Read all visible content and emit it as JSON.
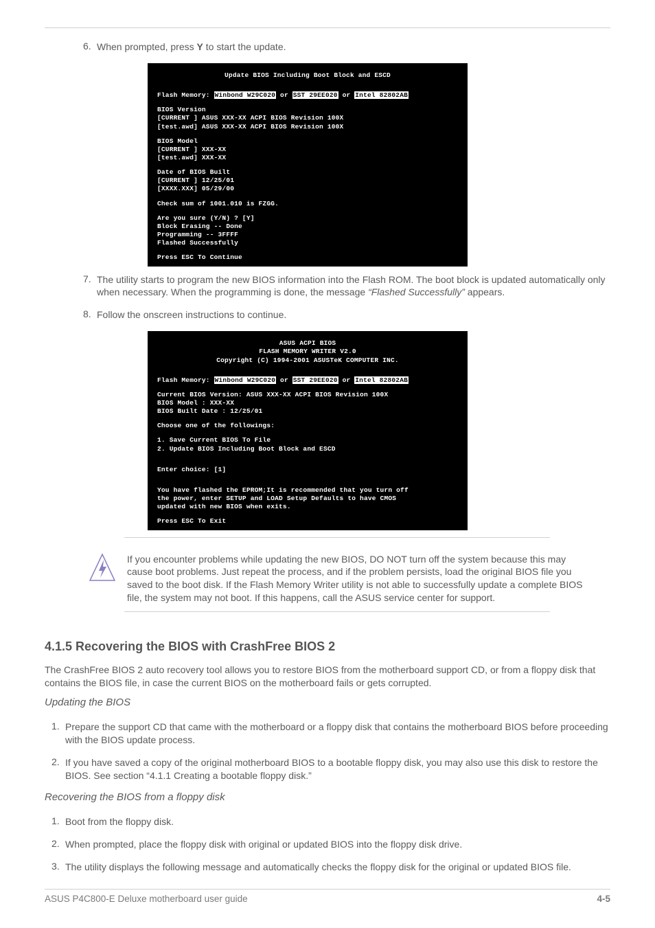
{
  "step6": {
    "num": "6.",
    "text_before": "When prompted, press ",
    "key": "Y",
    "text_after": " to start the update."
  },
  "bios1": {
    "title": "Update BIOS Including Boot Block and ESCD",
    "flash_label": "Flash Memory: ",
    "flash1": "Winbond W29C020",
    "or": " or ",
    "flash2": "SST 29EE020",
    "flash3": "Intel 82802AB",
    "bv_header": "BIOS Version",
    "bv_current": "[CURRENT ] ASUS XXX-XX ACPI BIOS Revision 100X",
    "bv_test": "[test.awd] ASUS XXX-XX ACPI BIOS Revision 100X",
    "bm_header": "BIOS Model",
    "bm_current": "[CURRENT ] XXX-XX",
    "bm_test": "[test.awd] XXX-XX",
    "date_header": "Date of BIOS Built",
    "date_current": "[CURRENT ] 12/25/01",
    "date_test": "[XXXX.XXX] 05/29/00",
    "checksum": "Check sum of 1001.010 is FZGG.",
    "confirm_q": "Are you sure (Y/N) ? ",
    "confirm_a": "[Y]",
    "erase_l": "Block Erasing  -- ",
    "erase_r": "Done",
    "prog_l": "Programming    -- ",
    "prog_r": "3FFFF",
    "flashed": "Flashed Successfully",
    "press": "Press ",
    "esc": "ESC",
    "press2": " To Continue"
  },
  "step7": {
    "num": "7.",
    "text": "The utility starts to program the new BIOS information into the Flash ROM. The boot block is updated automatically only when necessary. When the programming is done, the message ",
    "italic": "“Flashed Successfully”",
    "text2": " appears."
  },
  "step8": {
    "num": "8.",
    "text": "Follow the onscreen instructions to continue."
  },
  "bios2": {
    "t1": "ASUS ACPI BIOS",
    "t2": "FLASH MEMORY WRITER V2.0",
    "t3": "Copyright (C) 1994-2001 ASUSTeK COMPUTER INC.",
    "cur_bios": "Current BIOS Version: ",
    "cur_bios_v": "ASUS XXX-XX ACPI BIOS Revision 100X",
    "model_l": "BIOS Model          : ",
    "model_v": "XXX-XX",
    "built_l": "BIOS Built Date     : ",
    "built_v": "12/25/01",
    "choose": "Choose one of the followings:",
    "opt1": "1. Save Current BIOS To File",
    "opt2": "2. Update BIOS Including Boot Block and ESCD",
    "enter_l": "Enter choice: ",
    "enter_v": "[1]",
    "msg1": "You have flashed the EPROM;It is recommended that you turn off",
    "msg2": "the power, enter SETUP and LOAD Setup Defaults to have CMOS",
    "msg3": "updated with new BIOS when exits.",
    "press": "Press ",
    "esc": "ESC",
    "press2": " To Exit"
  },
  "note": "If you encounter problems while updating the new BIOS, DO NOT turn off the system because this may cause boot problems. Just repeat the process, and if the problem persists, load the original BIOS file you saved to the boot disk. If the Flash Memory Writer utility is not able to successfully update a complete BIOS file, the system may not boot. If this happens, call the ASUS service center for support.",
  "crashfree": {
    "title": "4.1.5 Recovering the BIOS with CrashFree BIOS 2",
    "sub1": "Updating the BIOS",
    "sub2": "Recovering the BIOS from a floppy disk",
    "intro": "The CrashFree BIOS 2 auto recovery tool allows you to restore BIOS from the motherboard support CD, or from a floppy disk that contains the BIOS file, in case the current BIOS on the motherboard fails or gets corrupted.",
    "step1_num": "1.",
    "step1": "Prepare the support CD that came with the motherboard or a floppy disk that contains the motherboard BIOS before proceeding with the BIOS update process.",
    "step2_num": "2.",
    "step2": "If you have saved a copy of the original motherboard BIOS to a bootable floppy disk, you may also use this disk to restore the BIOS. See section “4.1.1 Creating a bootable floppy disk.”",
    "rec1_num": "1.",
    "rec1": "Boot from the floppy disk.",
    "rec2_num": "2.",
    "rec2": "When prompted, place the floppy disk with original or updated BIOS into the floppy disk drive.",
    "rec3_num": "3.",
    "rec3": "The utility displays the following message and automatically checks the floppy disk for the original or updated BIOS file."
  },
  "footer": {
    "left": "ASUS P4C800-E Deluxe motherboard user guide",
    "right": "4-5"
  }
}
